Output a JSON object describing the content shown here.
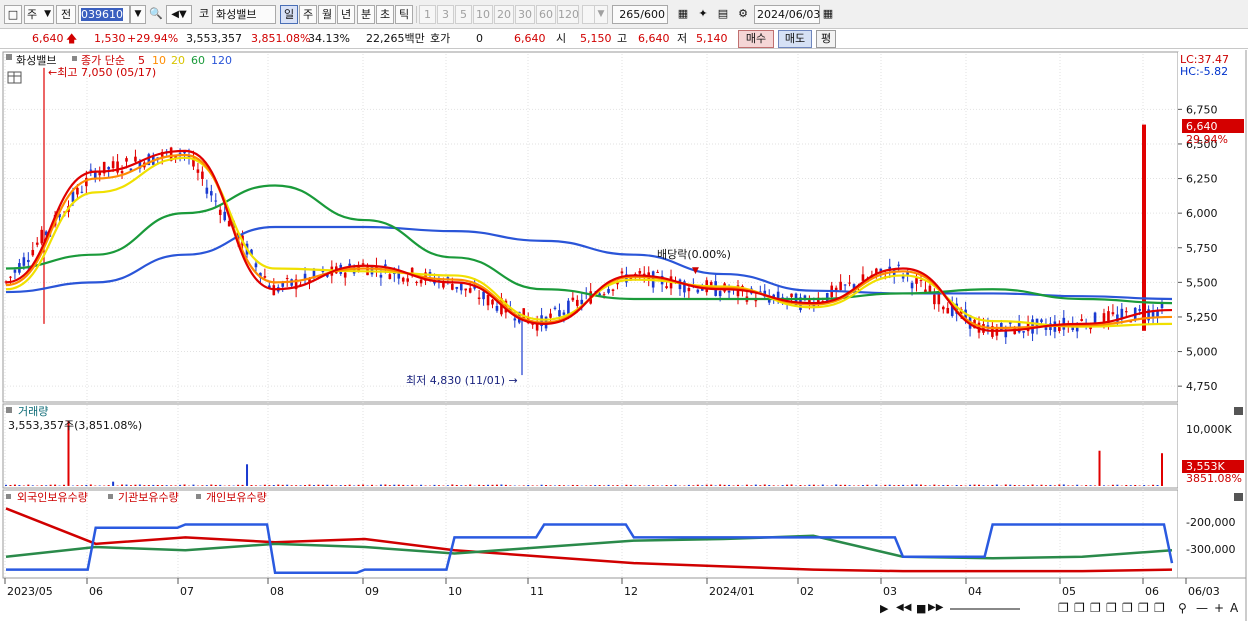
{
  "toolbar": {
    "market_label": "주",
    "period_type": "전",
    "stock_code": "039610",
    "code_label": "코",
    "stock_name": "화성밸브",
    "period_buttons": [
      "일",
      "주",
      "월",
      "년",
      "분",
      "초",
      "틱"
    ],
    "interval_buttons": [
      "1",
      "3",
      "5",
      "10",
      "20",
      "30",
      "60",
      "120"
    ],
    "count": "265",
    "count_max": "/600",
    "date": "2024/06/03"
  },
  "quote": {
    "price": "6,640",
    "change": "1,530",
    "change_pct": "+29.94%",
    "volume": "3,553,357",
    "volume_pct": "3,851.08%",
    "turnover_pct": "34.13%",
    "amount": "22,265백만",
    "hoga_label": "호가",
    "hoga_value": "0",
    "hoga_price": "6,640",
    "open_label": "시",
    "open": "5,150",
    "high_label": "고",
    "high": "6,640",
    "low_label": "저",
    "low": "5,140",
    "buy_label": "매수",
    "sell_label": "매도",
    "eval_label": "평"
  },
  "price_panel": {
    "stock_label": "화성밸브",
    "ma_label": "종가 단순",
    "ma_periods": [
      "5",
      "10",
      "20",
      "60",
      "120"
    ],
    "high_note": "최고 7,050 (05/17)",
    "low_note": "최저 4,830 (11/01)",
    "dividend_note": "배당락(0.00%)",
    "lc_label": "LC:37.47",
    "hc_label": "HC:-5.82",
    "current_price": "6,640",
    "current_pct": "29.94%",
    "y_ticks": [
      "6,750",
      "6,500",
      "6,250",
      "6,000",
      "5,750",
      "5,500",
      "5,250",
      "5,000",
      "4,750"
    ]
  },
  "volume_panel": {
    "title": "거래량",
    "value": "3,553,357주(3,851.08%)",
    "y_tick": "10,000K",
    "current": "3,553K",
    "current_pct": "3851.08%"
  },
  "holding_panel": {
    "legend": [
      "외국인보유수량",
      "기관보유수량",
      "개인보유수량"
    ],
    "y_ticks": [
      "-200,000",
      "-300,000"
    ]
  },
  "x_axis": {
    "labels": [
      "2023/05",
      "06",
      "07",
      "08",
      "09",
      "10",
      "11",
      "12",
      "2024/01",
      "02",
      "03",
      "04",
      "05",
      "06",
      "06/03"
    ]
  },
  "colors": {
    "ma5": "#e00000",
    "ma10": "#ff8c00",
    "ma20": "#f0e000",
    "ma60": "#1a9a3a",
    "ma120": "#2a55d8",
    "up": "#e00000",
    "down": "#1a3ad0",
    "foreign": "#d00000",
    "institution": "#2a8a4a",
    "individual": "#2a5ae0"
  },
  "chart_data": {
    "type": "line",
    "title": "",
    "x": [
      "2023/05",
      "06",
      "07",
      "08",
      "09",
      "10",
      "11",
      "12",
      "2024/01",
      "02",
      "03",
      "04",
      "05",
      "06"
    ],
    "series": [
      {
        "name": "5",
        "values": [
          5500,
          6300,
          6450,
          5450,
          5620,
          5500,
          5200,
          5550,
          5450,
          5350,
          5600,
          5150,
          5200,
          5300
        ]
      },
      {
        "name": "10",
        "values": [
          5480,
          6250,
          6420,
          5500,
          5600,
          5520,
          5210,
          5540,
          5460,
          5340,
          5580,
          5170,
          5190,
          5250
        ]
      },
      {
        "name": "20",
        "values": [
          5450,
          6150,
          6400,
          5600,
          5580,
          5550,
          5230,
          5520,
          5470,
          5320,
          5550,
          5220,
          5180,
          5200
        ]
      },
      {
        "name": "60",
        "values": [
          5600,
          5700,
          6000,
          6200,
          5950,
          5680,
          5450,
          5380,
          5380,
          5380,
          5420,
          5450,
          5380,
          5350
        ]
      },
      {
        "name": "120",
        "values": [
          5430,
          5500,
          5700,
          5900,
          5900,
          5870,
          5800,
          5700,
          5560,
          5440,
          5420,
          5420,
          5400,
          5380
        ]
      }
    ],
    "ylim": [
      4750,
      7050
    ],
    "high": {
      "value": 7050,
      "date": "05/17"
    },
    "low": {
      "value": 4830,
      "date": "11/01"
    },
    "last": 6640,
    "volume_last_k": 3553,
    "holding": {
      "foreign": [
        -150000,
        -260000,
        -240000,
        -255000,
        -245000,
        -280000,
        -300000,
        -320000,
        -330000,
        -340000,
        -345000,
        -345000,
        -345000,
        -340000
      ],
      "institution": [
        -300000,
        -270000,
        -280000,
        -260000,
        -270000,
        -290000,
        -270000,
        -250000,
        -245000,
        -235000,
        -300000,
        -305000,
        -300000,
        -280000
      ],
      "individual": [
        -340000,
        -210000,
        -200000,
        -350000,
        -340000,
        -240000,
        -200000,
        -240000,
        -240000,
        -240000,
        -300000,
        -200000,
        -200000,
        -320000
      ]
    }
  }
}
